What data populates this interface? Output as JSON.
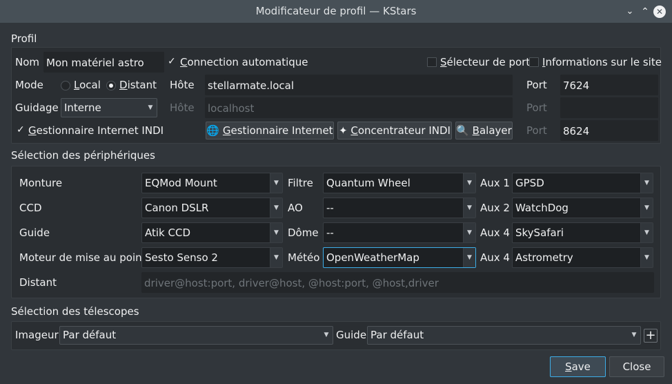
{
  "window": {
    "title": "Modificateur de profil — KStars",
    "controls": [
      "chevron-down",
      "chevron-up",
      "close"
    ]
  },
  "profile": {
    "section_title": "Profil",
    "name_label": "Nom",
    "name_value": "Mon matériel astro",
    "auto_connect_label": "Connection automatique",
    "auto_connect_checked": true,
    "port_selector_label": "Sélecteur de port",
    "port_selector_checked": false,
    "site_info_label": "Informations sur le site",
    "site_info_checked": false,
    "mode_label": "Mode",
    "mode_local": "Local",
    "mode_remote": "Distant",
    "mode_selected": "Distant",
    "host_label": "Hôte",
    "host_value": "stellarmate.local",
    "port_label": "Port",
    "port_value": "7624",
    "guiding_label": "Guidage",
    "guiding_value": "Interne",
    "guide_host_label": "Hôte",
    "guide_host_placeholder": "localhost",
    "guide_port_label": "Port",
    "guide_port_value": "",
    "indi_web_manager_label": "Gestionnaire Internet INDI",
    "indi_web_manager_checked": true,
    "web_manager_button": "Gestionnaire Internet",
    "indi_hub_button": "Concentrateur INDI",
    "scan_button": "Balayer",
    "web_port_label": "Port",
    "web_port_value": "8624"
  },
  "devices": {
    "section_title": "Sélection des périphériques",
    "mount_label": "Monture",
    "mount_value": "EQMod Mount",
    "ccd_label": "CCD",
    "ccd_value": "Canon DSLR",
    "guide_label": "Guide",
    "guide_value": "Atik CCD",
    "focuser_label": "Moteur de mise au point",
    "focuser_value": "Sesto Senso 2",
    "remote_label": "Distant",
    "remote_placeholder": "driver@host:port, driver@host, @host:port, @host,driver",
    "filter_label": "Filtre",
    "filter_value": "Quantum Wheel",
    "ao_label": "AO",
    "ao_value": "--",
    "dome_label": "Dôme",
    "dome_value": "--",
    "weather_label": "Météo",
    "weather_value": "OpenWeatherMap",
    "aux1_label": "Aux 1",
    "aux1_value": "GPSD",
    "aux2_label": "Aux 2",
    "aux2_value": "WatchDog",
    "aux3_label": "Aux 4",
    "aux3_value": "SkySafari",
    "aux4_label": "Aux 4",
    "aux4_value": "Astrometry"
  },
  "telescopes": {
    "section_title": "Sélection des télescopes",
    "imager_label": "Imageur",
    "imager_value": "Par défaut",
    "guide_label": "Guide",
    "guide_value": "Par défaut",
    "add_button": "+"
  },
  "footer": {
    "save_button": "Save",
    "close_button": "Close"
  },
  "colors": {
    "accent": "#3daee9",
    "background": "#31363b",
    "panel": "#2a2e32",
    "titlebar": "#475057"
  }
}
